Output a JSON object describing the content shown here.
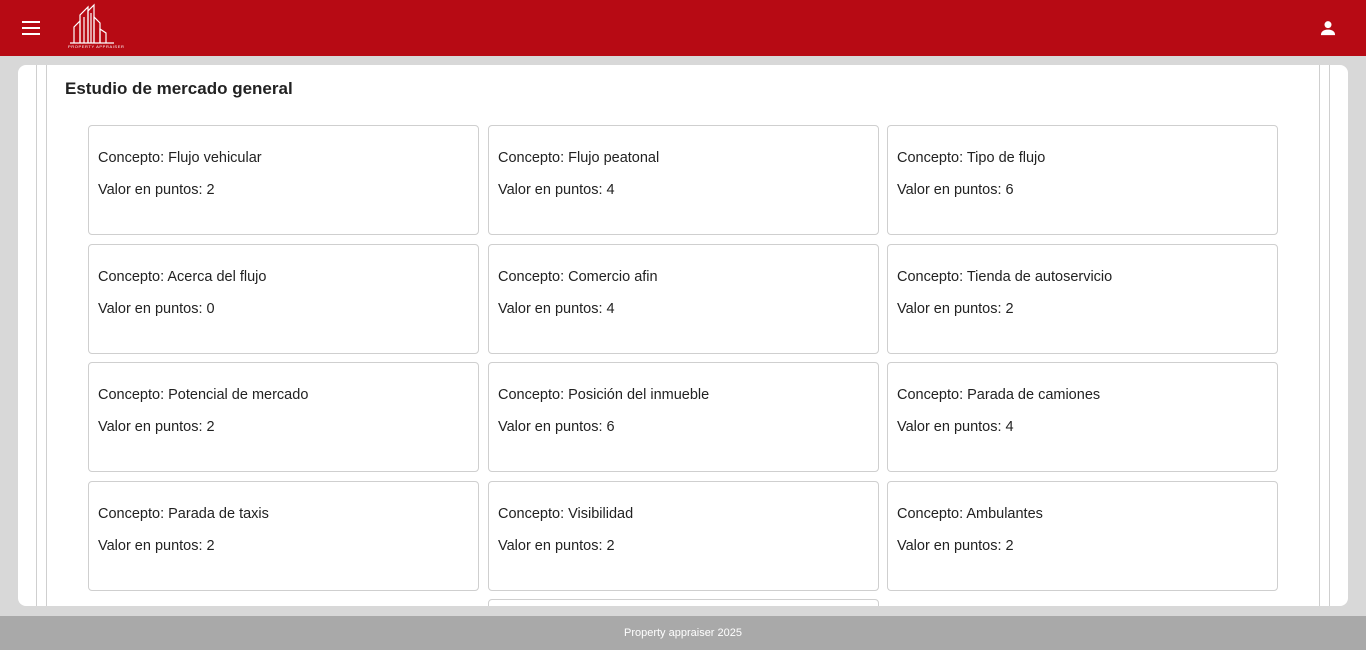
{
  "header": {
    "logo_text": "PROPERTY APPRAISER",
    "menu_icon": "menu-icon",
    "user_icon": "person-icon",
    "color": "#b70a14"
  },
  "section": {
    "title": "Estudio de mercado general"
  },
  "cards": [
    {
      "concept": "Concepto: Flujo vehicular",
      "value": "Valor en puntos: 2"
    },
    {
      "concept": "Concepto: Flujo peatonal",
      "value": "Valor en puntos: 4"
    },
    {
      "concept": "Concepto: Tipo de flujo",
      "value": "Valor en puntos: 6"
    },
    {
      "concept": "Concepto: Acerca del flujo",
      "value": "Valor en puntos: 0"
    },
    {
      "concept": "Concepto: Comercio afin",
      "value": "Valor en puntos: 4"
    },
    {
      "concept": "Concepto: Tienda de autoservicio",
      "value": "Valor en puntos: 2"
    },
    {
      "concept": "Concepto: Potencial de mercado",
      "value": "Valor en puntos: 2"
    },
    {
      "concept": "Concepto: Posición del inmueble",
      "value": "Valor en puntos: 6"
    },
    {
      "concept": "Concepto: Parada de camiones",
      "value": "Valor en puntos: 4"
    },
    {
      "concept": "Concepto: Parada de taxis",
      "value": "Valor en puntos: 2"
    },
    {
      "concept": "Concepto: Visibilidad",
      "value": "Valor en puntos: 2"
    },
    {
      "concept": "Concepto: Ambulantes",
      "value": "Valor en puntos: 2"
    }
  ],
  "footer": {
    "text": "Property appraiser 2025"
  }
}
